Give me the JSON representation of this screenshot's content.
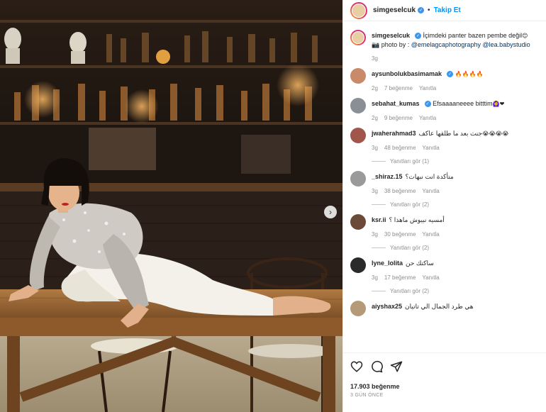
{
  "post": {
    "username": "simgeselcuk",
    "follow_label": "Takip Et",
    "separator": "•"
  },
  "caption": {
    "username": "simgeselcuk",
    "text": "İçimdeki panter bazen pembe değil",
    "emoji": "😊",
    "photo_prefix": "📷 photo by : ",
    "tag1": "@emelagcaphotography",
    "tag2": "@lea.babystudio",
    "time": "3g"
  },
  "comments": [
    {
      "username": "aysunbolukbasimamak",
      "verified": true,
      "text": "",
      "emoji": "🔥🔥🔥🔥",
      "time": "2g",
      "likes": "7 beğenme",
      "reply": "Yanıtla",
      "replies": "",
      "avatar_color": "#c98a6a"
    },
    {
      "username": "sebahat_kumas",
      "verified": true,
      "text": "Efsaaaaneeee bitttim",
      "emoji": "🙆‍♀️❤",
      "time": "2g",
      "likes": "9 beğenme",
      "reply": "Yanıtla",
      "replies": "",
      "avatar_color": "#8a8f96"
    },
    {
      "username": "jwaherahmad3",
      "verified": false,
      "text": "جنت بعد ما طلقها عاكف",
      "emoji": "😭😭😭😭",
      "time": "3g",
      "likes": "48 beğenme",
      "reply": "Yanıtla",
      "replies": "Yanıtları gör (1)",
      "avatar_color": "#a0564a"
    },
    {
      "username": "_shiraz.15",
      "verified": false,
      "text": "متأكدة انت نبهات؟",
      "emoji": "",
      "time": "3g",
      "likes": "38 beğenme",
      "reply": "Yanıtla",
      "replies": "Yanıtları gör (2)",
      "avatar_color": "#9a9a9a"
    },
    {
      "username": "ksr.ii",
      "verified": false,
      "text": "أمسيه نبيوش ماهذا ؟",
      "emoji": "",
      "time": "3g",
      "likes": "30 beğenme",
      "reply": "Yanıtla",
      "replies": "Yanıtları gör (2)",
      "avatar_color": "#6b4a3a"
    },
    {
      "username": "lyne_lolita",
      "verified": false,
      "text": "ساكتك حن",
      "emoji": "",
      "time": "3g",
      "likes": "17 beğenme",
      "reply": "Yanıtla",
      "replies": "Yanıtları gör (2)",
      "avatar_color": "#2a2a2a"
    },
    {
      "username": "aiyshax25",
      "verified": false,
      "text": "هي طرد الجمال الي تاتيان",
      "emoji": "",
      "time": "",
      "likes": "",
      "reply": "",
      "replies": "",
      "avatar_color": "#b59a7a"
    }
  ],
  "footer": {
    "likes": "17.903 beğenme",
    "date": "3 GÜN ÖNCE"
  },
  "icons": {
    "heart": "heart-icon",
    "comment": "comment-icon",
    "share": "share-icon",
    "next": "chevron-right-icon"
  }
}
